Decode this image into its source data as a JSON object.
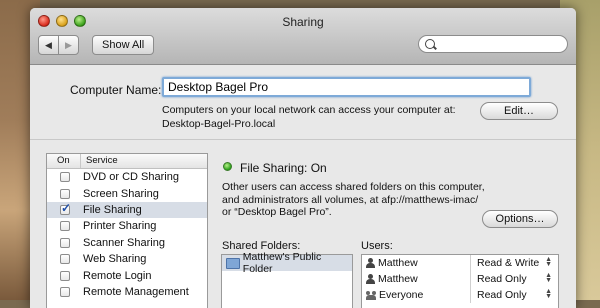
{
  "window": {
    "title": "Sharing"
  },
  "toolbar": {
    "back": "◀",
    "forward": "▶",
    "show_all": "Show All",
    "search_placeholder": ""
  },
  "computer_name": {
    "label": "Computer Name:",
    "value": "Desktop Bagel Pro",
    "info_line1": "Computers on your local network can access your computer at:",
    "info_line2": "Desktop-Bagel-Pro.local",
    "edit_button": "Edit…"
  },
  "services": {
    "header_on": "On",
    "header_service": "Service",
    "items": [
      {
        "label": "DVD or CD Sharing",
        "checked": false
      },
      {
        "label": "Screen Sharing",
        "checked": false
      },
      {
        "label": "File Sharing",
        "checked": true
      },
      {
        "label": "Printer Sharing",
        "checked": false
      },
      {
        "label": "Scanner Sharing",
        "checked": false
      },
      {
        "label": "Web Sharing",
        "checked": false
      },
      {
        "label": "Remote Login",
        "checked": false
      },
      {
        "label": "Remote Management",
        "checked": false
      }
    ],
    "selected_index": 2
  },
  "detail": {
    "status": "File Sharing: On",
    "status_color": "#28a018",
    "desc_line1": "Other users can access shared folders on this computer,",
    "desc_line2": "and administrators all volumes, at afp://matthews-imac/",
    "desc_line3": "or “Desktop Bagel Pro”.",
    "options_button": "Options…"
  },
  "shared_folders": {
    "label": "Shared Folders:",
    "items": [
      {
        "name": "Matthew's Public Folder"
      }
    ]
  },
  "users": {
    "label": "Users:",
    "items": [
      {
        "name": "Matthew",
        "permission": "Read & Write",
        "icon": "user-icon"
      },
      {
        "name": "Matthew",
        "permission": "Read Only",
        "icon": "user-icon"
      },
      {
        "name": "Everyone",
        "permission": "Read Only",
        "icon": "group-icon"
      }
    ]
  }
}
